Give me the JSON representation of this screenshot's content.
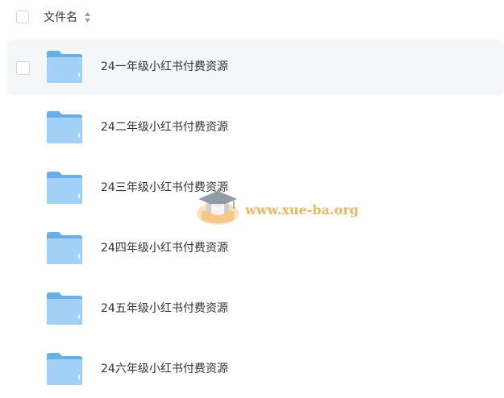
{
  "header": {
    "column_label": "文件名"
  },
  "files": [
    {
      "name": "24一年级小红书付费资源",
      "highlighted": true,
      "show_checkbox": true
    },
    {
      "name": "24二年级小红书付费资源",
      "highlighted": false,
      "show_checkbox": false
    },
    {
      "name": "24三年级小红书付费资源",
      "highlighted": false,
      "show_checkbox": false
    },
    {
      "name": "24四年级小红书付费资源",
      "highlighted": false,
      "show_checkbox": false
    },
    {
      "name": "24五年级小红书付费资源",
      "highlighted": false,
      "show_checkbox": false
    },
    {
      "name": "24六年级小红书付费资源",
      "highlighted": false,
      "show_checkbox": false
    }
  ],
  "watermark": {
    "text": "www.xue-ba.org"
  },
  "colors": {
    "folder_back": "#6aaee8",
    "folder_front": "#9fcdf5",
    "row_hover": "#f5f6f8",
    "watermark": "#e8a94a"
  }
}
